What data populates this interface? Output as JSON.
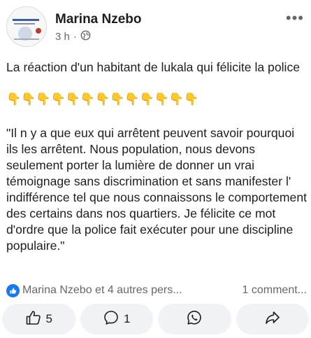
{
  "post": {
    "author": "Marina Nzebo",
    "time": "3 h",
    "separator": "·",
    "more": "•••",
    "text": "La réaction d'un habitant de lukala qui félicite la police",
    "hands": "👇👇👇👇👇👇👇👇👇👇👇👇👇",
    "quote": "\"Il n y a que eux qui arrêtent peuvent savoir pourquoi ils les arrêtent. Nous population, nous devons seulement porter la lumière de donner un vrai témoignage sans discrimination et sans manifester l' indifférence tel que nous connaissons le comportement des certains dans nos quartiers. Je félicite ce mot d'ordre que la police fait exécuter pour une discipline populaire.\""
  },
  "reactions": {
    "text": "Marina Nzebo et 4 autres pers...",
    "comments": "1 comment..."
  },
  "actions": {
    "like_count": "5",
    "comment_count": "1"
  },
  "colors": {
    "accent": "#1877f2",
    "meta_gray": "#65676b",
    "button_bg": "#f0f2f5"
  }
}
